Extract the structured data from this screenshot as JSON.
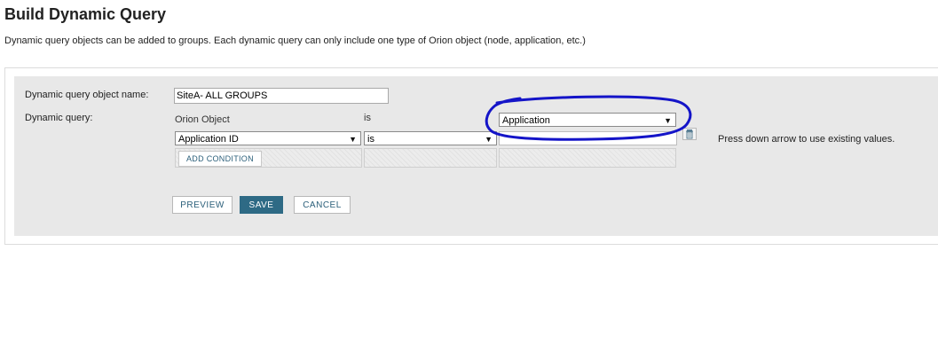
{
  "page": {
    "title": "Build Dynamic Query",
    "description": "Dynamic query objects can be added to groups. Each dynamic query can only include one type of Orion object (node, application, etc.)"
  },
  "form": {
    "name_label": "Dynamic query object name:",
    "name_value": "SiteA- ALL GROUPS",
    "query_label": "Dynamic query:",
    "columns": {
      "object": "Orion Object",
      "operator": "is"
    },
    "object_type": "Application",
    "condition": {
      "field": "Application ID",
      "operator": "is",
      "value": ""
    },
    "hint": "Press down arrow to use existing values.",
    "add_condition_label": "ADD CONDITION"
  },
  "buttons": {
    "preview": "PREVIEW",
    "save": "SAVE",
    "cancel": "CANCEL"
  },
  "colors": {
    "primary_button": "#2e6a85",
    "annotation_circle": "#1414c8"
  },
  "icons": {
    "delete": "trash-icon",
    "dropdown": "triangle-down-icon"
  }
}
